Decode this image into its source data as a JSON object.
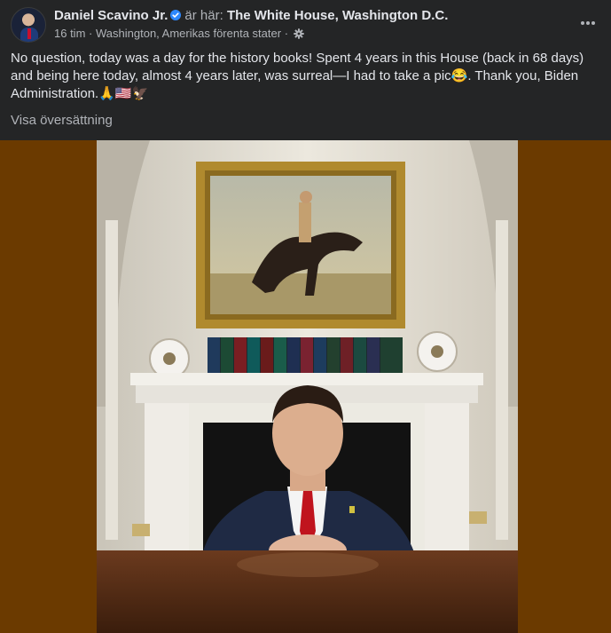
{
  "post": {
    "author": "Daniel Scavino Jr.",
    "location_prefix": "är här:",
    "location": "The White House, Washington D.C.",
    "time": "16 tim",
    "place": "Washington, Amerikas förenta stater",
    "separator": "·",
    "body": "No question, today was a day for the history books! Spent 4 years in this House (back in 68 days) and being here today, almost 4 years later, was surreal—I had to take a pic😂. Thank you, Biden Administration.🙏🇺🇸🦅",
    "translate_link": "Visa översättning"
  },
  "icons": {
    "verified": "verified-badge-icon",
    "privacy": "public-gear-icon",
    "more": "more-options-icon"
  },
  "colors": {
    "background": "#242526",
    "text_primary": "#e4e6eb",
    "text_secondary": "#b0b3b8",
    "verified_blue": "#2d88ff",
    "photo_letterbox": "#6b3a00"
  }
}
